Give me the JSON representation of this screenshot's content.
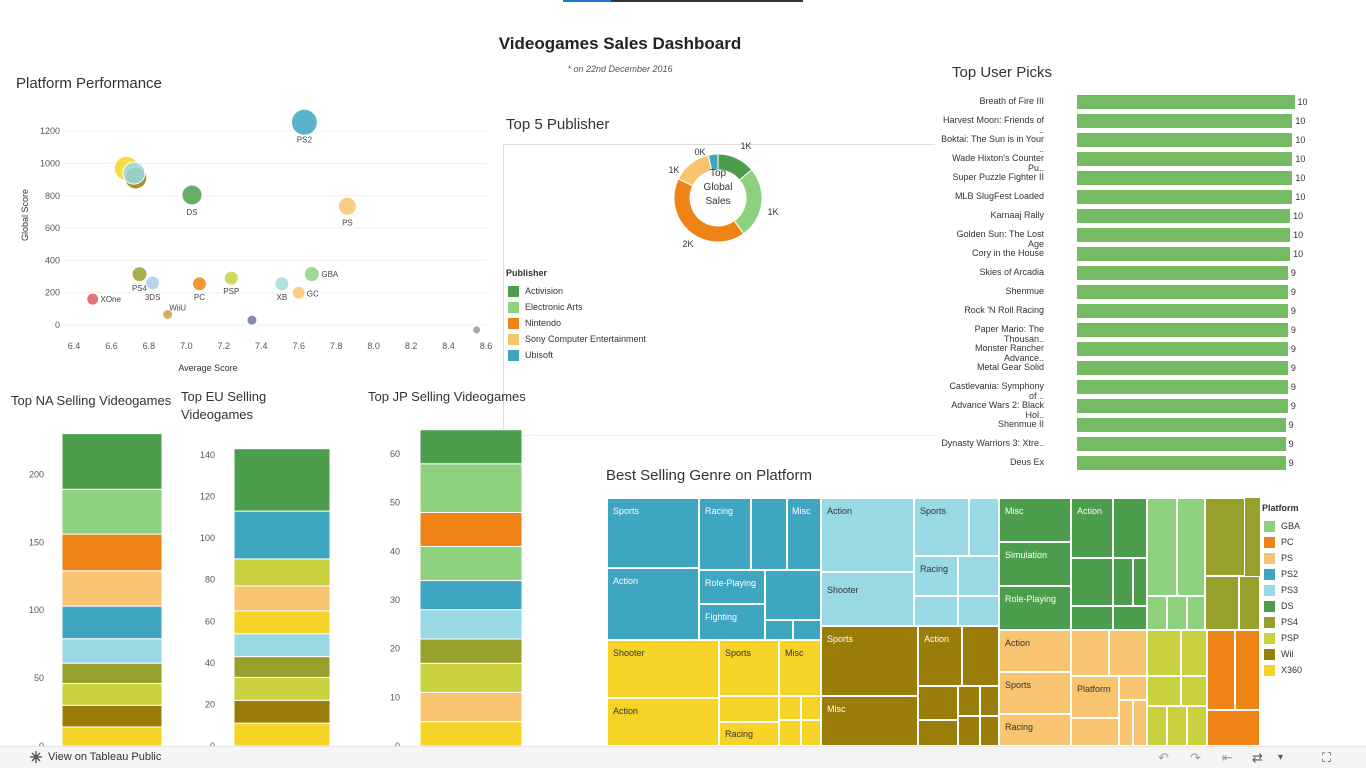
{
  "dashboard": {
    "title": "Videogames Sales Dashboard",
    "subtitle": "* on 22nd December 2016"
  },
  "platform_performance": {
    "title": "Platform Performance",
    "chart_data": {
      "type": "scatter",
      "xlabel": "Average Score",
      "ylabel": "Global Score",
      "xlim": [
        6.4,
        8.6
      ],
      "ylim": [
        0,
        1300
      ],
      "x_ticks": [
        "6.4",
        "6.6",
        "6.8",
        "7.0",
        "7.2",
        "7.4",
        "7.6",
        "7.8",
        "8.0",
        "8.2",
        "8.4",
        "8.6"
      ],
      "y_ticks": [
        "0",
        "200",
        "400",
        "600",
        "800",
        "1000",
        "1200"
      ],
      "points": [
        {
          "label": "PS2",
          "x": 7.63,
          "y": 1255,
          "color": "#3ea6c1",
          "size": 1.0
        },
        {
          "label": "",
          "x": 6.68,
          "y": 970,
          "color": "#f5d327",
          "size": 0.9
        },
        {
          "label": "",
          "x": 6.73,
          "y": 910,
          "color": "#9a7d09",
          "size": 0.8
        },
        {
          "label": "",
          "x": 6.72,
          "y": 940,
          "color": "#98d9e4",
          "size": 0.8
        },
        {
          "label": "DS",
          "x": 7.03,
          "y": 805,
          "color": "#4c9e4c",
          "size": 0.7
        },
        {
          "label": "PS",
          "x": 7.86,
          "y": 735,
          "color": "#f9c470",
          "size": 0.6
        },
        {
          "label": "GBA",
          "x": 7.67,
          "y": 315,
          "color": "#8dd17f",
          "size": 0.45
        },
        {
          "label": "PS4",
          "x": 6.75,
          "y": 315,
          "color": "#98a02c",
          "size": 0.45
        },
        {
          "label": "3DS",
          "x": 6.82,
          "y": 260,
          "color": "#a6cfe8",
          "size": 0.4
        },
        {
          "label": "PC",
          "x": 7.07,
          "y": 255,
          "color": "#ee8416",
          "size": 0.4
        },
        {
          "label": "PSP",
          "x": 7.24,
          "y": 290,
          "color": "#c9d13f",
          "size": 0.4
        },
        {
          "label": "XB",
          "x": 7.51,
          "y": 255,
          "color": "#a8d8dc",
          "size": 0.4
        },
        {
          "label": "GC",
          "x": 7.6,
          "y": 200,
          "color": "#f9c470",
          "size": 0.35
        },
        {
          "label": "XOne",
          "x": 6.5,
          "y": 160,
          "color": "#e05a5a",
          "size": 0.3
        },
        {
          "label": "WiiU",
          "x": 6.9,
          "y": 65,
          "color": "#c9a04a",
          "size": 0.2
        },
        {
          "label": "",
          "x": 7.35,
          "y": 30,
          "color": "#6b7a9a",
          "size": 0.2
        },
        {
          "label": "",
          "x": 8.55,
          "y": -30,
          "color": "#999999",
          "size": 0.1
        }
      ]
    }
  },
  "top_publisher": {
    "title": "Top 5 Publisher",
    "center_label": [
      "Top",
      "Global",
      "Sales"
    ],
    "legend_title": "Publisher",
    "chart_data": {
      "type": "pie",
      "slices": [
        {
          "name": "Activision",
          "value": 590,
          "color": "#4c9e4c",
          "label": "1K"
        },
        {
          "name": "Electronic Arts",
          "value": 1110,
          "color": "#8dd17f",
          "label": "1K"
        },
        {
          "name": "Nintendo",
          "value": 1780,
          "color": "#ee8416",
          "label": "2K"
        },
        {
          "name": "Sony Computer Entertainment",
          "value": 607,
          "color": "#f9c470",
          "label": "1K"
        },
        {
          "name": "Ubisoft",
          "value": 150,
          "color": "#3ea6c1",
          "label": "0K"
        }
      ]
    }
  },
  "top_user_picks": {
    "title": "Top User Picks",
    "chart_data": {
      "type": "bar",
      "bar_color": "#74bb63",
      "categories": [
        "Breath of Fire III",
        "Harvest Moon: Friends of ..",
        "Boktai: The Sun is in Your ..",
        "Wade Hixton's Counter Pu..",
        "Super Puzzle Fighter II",
        "MLB SlugFest Loaded",
        "Karnaaj Rally",
        "Golden Sun: The Lost Age",
        "Cory in the House",
        "Skies of Arcadia",
        "Shenmue",
        "Rock 'N Roll Racing",
        "Paper Mario: The Thousan..",
        "Monster Rancher Advance..",
        "Metal Gear Solid",
        "Castlevania: Symphony of ..",
        "Advance Wars 2: Black Hol..",
        "Shenmue II",
        "Dynasty Warriors 3: Xtre..",
        "Deus Ex"
      ],
      "values": [
        9.8,
        9.7,
        9.7,
        9.7,
        9.7,
        9.7,
        9.6,
        9.6,
        9.6,
        9.5,
        9.5,
        9.5,
        9.5,
        9.5,
        9.5,
        9.5,
        9.5,
        9.4,
        9.4,
        9.4
      ],
      "labels": [
        "10",
        "10",
        "10",
        "10",
        "10",
        "10",
        "10",
        "10",
        "10",
        "9",
        "9",
        "9",
        "9",
        "9",
        "9",
        "9",
        "9",
        "9",
        "9",
        "9"
      ]
    }
  },
  "na_sales": {
    "title": "Top NA Selling Videogames",
    "chart_data": {
      "type": "bar",
      "ylim": [
        0,
        240
      ],
      "y_ticks": [
        "0",
        "50",
        "100",
        "150",
        "200"
      ],
      "y_tick_values": [
        0,
        50,
        100,
        150,
        200
      ],
      "segments": [
        {
          "value": 14,
          "color": "#f5d327"
        },
        {
          "value": 16,
          "color": "#9a7d09"
        },
        {
          "value": 16,
          "color": "#c9d13f"
        },
        {
          "value": 15,
          "color": "#98a02c"
        },
        {
          "value": 18,
          "color": "#98d9e4"
        },
        {
          "value": 24,
          "color": "#3ea6c1"
        },
        {
          "value": 26,
          "color": "#f9c470"
        },
        {
          "value": 27,
          "color": "#ee8416"
        },
        {
          "value": 33,
          "color": "#8dd17f"
        },
        {
          "value": 41,
          "color": "#4c9e4c"
        }
      ]
    }
  },
  "eu_sales": {
    "title": "Top EU Selling Videogames",
    "title_lines": [
      "Top EU Selling",
      "Videogames"
    ],
    "chart_data": {
      "type": "bar",
      "ylim": [
        0,
        152
      ],
      "y_ticks": [
        "0",
        "20",
        "40",
        "60",
        "80",
        "100",
        "120",
        "140"
      ],
      "y_tick_values": [
        0,
        20,
        40,
        60,
        80,
        100,
        120,
        140
      ],
      "segments": [
        {
          "value": 11,
          "color": "#f5d327"
        },
        {
          "value": 11,
          "color": "#9a7d09"
        },
        {
          "value": 11,
          "color": "#c9d13f"
        },
        {
          "value": 10,
          "color": "#98a02c"
        },
        {
          "value": 11,
          "color": "#98d9e4"
        },
        {
          "value": 11,
          "color": "#f5d327"
        },
        {
          "value": 12,
          "color": "#f9c470"
        },
        {
          "value": 13,
          "color": "#c9d13f"
        },
        {
          "value": 23,
          "color": "#3ea6c1"
        },
        {
          "value": 30,
          "color": "#4c9e4c"
        }
      ]
    }
  },
  "jp_sales": {
    "title": "Top JP Selling Videogames",
    "chart_data": {
      "type": "bar",
      "ylim": [
        0,
        67
      ],
      "y_ticks": [
        "0",
        "10",
        "20",
        "30",
        "40",
        "50",
        "60"
      ],
      "y_tick_values": [
        0,
        10,
        20,
        30,
        40,
        50,
        60
      ],
      "segments": [
        {
          "value": 5,
          "color": "#f5d327"
        },
        {
          "value": 6,
          "color": "#f9c470"
        },
        {
          "value": 6,
          "color": "#c9d13f"
        },
        {
          "value": 5,
          "color": "#98a02c"
        },
        {
          "value": 6,
          "color": "#98d9e4"
        },
        {
          "value": 6,
          "color": "#3ea6c1"
        },
        {
          "value": 7,
          "color": "#8dd17f"
        },
        {
          "value": 7,
          "color": "#ee8416"
        },
        {
          "value": 10,
          "color": "#8dd17f"
        },
        {
          "value": 7,
          "color": "#4c9e4c"
        }
      ]
    }
  },
  "genre_treemap": {
    "title": "Best Selling Genre on Platform",
    "legend_title": "Platform",
    "legend": [
      {
        "name": "GBA",
        "color": "#8dd17f"
      },
      {
        "name": "PC",
        "color": "#ee8416"
      },
      {
        "name": "PS",
        "color": "#f9c470"
      },
      {
        "name": "PS2",
        "color": "#3ea6c1"
      },
      {
        "name": "PS3",
        "color": "#98d9e4"
      },
      {
        "name": "DS",
        "color": "#4c9e4c"
      },
      {
        "name": "PS4",
        "color": "#98a02c"
      },
      {
        "name": "PSP",
        "color": "#c9d13f"
      },
      {
        "name": "Wii",
        "color": "#9a7d09"
      },
      {
        "name": "X360",
        "color": "#f5d327"
      }
    ],
    "labels": {
      "ps2_sports": "Sports",
      "ps2_racing": "Racing",
      "ps2_misc": "Misc",
      "ps2_action": "Action",
      "ps2_roleplaying": "Role-Playing",
      "ps2_fighting": "Fighting",
      "ps3_action": "Action",
      "ps3_sports": "Sports",
      "ps3_racing": "Racing",
      "ps3_shooter": "Shooter",
      "ds_misc": "Misc",
      "ds_action": "Action",
      "ds_simulation": "Simulation",
      "ds_roleplaying": "Role-Playing",
      "x360_shooter": "Shooter",
      "x360_sports": "Sports",
      "x360_misc": "Misc",
      "x360_action": "Action",
      "x360_racing": "Racing",
      "wii_sports": "Sports",
      "wii_action": "Action",
      "wii_misc": "Misc",
      "ps_action": "Action",
      "ps_sports": "Sports",
      "ps_platform": "Platform",
      "ps_racing": "Racing"
    }
  },
  "footer": {
    "link_text": "View on Tableau Public"
  }
}
